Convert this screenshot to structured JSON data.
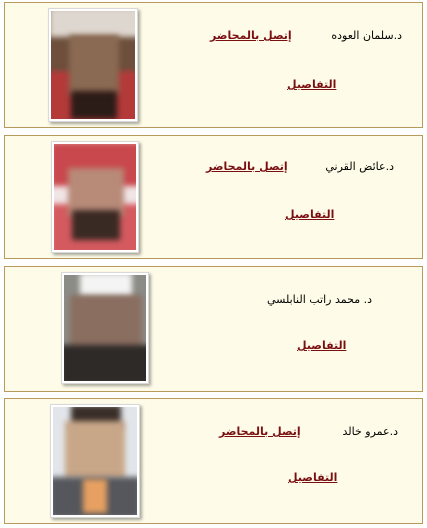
{
  "scholars": [
    {
      "name": "د.سلمان العوده",
      "contact_label": "إتصل بالمحاضر",
      "details_label": "التفاصيل",
      "photo_alt": "person-photo"
    },
    {
      "name": "د.عائض القرني",
      "contact_label": "إتصل بالمحاضر",
      "details_label": "التفاصيل",
      "photo_alt": "person-photo"
    },
    {
      "name": "د. محمد راتب النابلسي",
      "details_label": "التفاصيل",
      "photo_alt": "person-photo"
    },
    {
      "name": "د.عمرو خالد",
      "contact_label": "إتصل بالمحاضر",
      "details_label": "التفاصيل",
      "photo_alt": "person-photo"
    }
  ],
  "colors": {
    "card_background": "#fefce8",
    "card_border": "#b79a5c",
    "link_color": "#7a0f12"
  }
}
